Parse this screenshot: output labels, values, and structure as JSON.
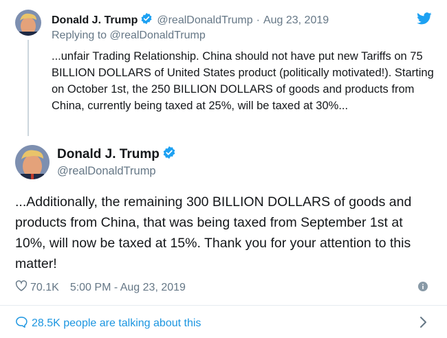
{
  "parent_tweet": {
    "name": "Donald J. Trump",
    "handle": "@realDonaldTrump",
    "separator": "·",
    "date": "Aug 23, 2019",
    "replying_to": "Replying to @realDonaldTrump",
    "text": "...unfair Trading Relationship. China should not have put new Tariffs on 75 BILLION DOLLARS of United States product (politically motivated!). Starting on October 1st, the 250 BILLION DOLLARS of goods and products from China, currently being taxed at 25%, will be taxed at 30%..."
  },
  "main_tweet": {
    "name": "Donald J. Trump",
    "handle": "@realDonaldTrump",
    "text": "...Additionally, the remaining 300 BILLION DOLLARS of goods and products from China, that was being taxed from September 1st at 10%, will now be taxed at 15%. Thank you for your attention to this matter!",
    "likes": "70.1K",
    "timestamp": "5:00 PM - Aug 23, 2019"
  },
  "talking": {
    "label": "28.5K people are talking about this"
  },
  "icons": {
    "verified": "verified-badge-icon",
    "bird": "twitter-bird-icon",
    "heart": "heart-icon",
    "info": "info-icon",
    "comment": "comment-bubble-icon",
    "chevron": "chevron-right-icon"
  },
  "colors": {
    "accent": "#1da1f2",
    "link": "#1b95e0",
    "muted": "#657786",
    "text": "#14171a"
  }
}
